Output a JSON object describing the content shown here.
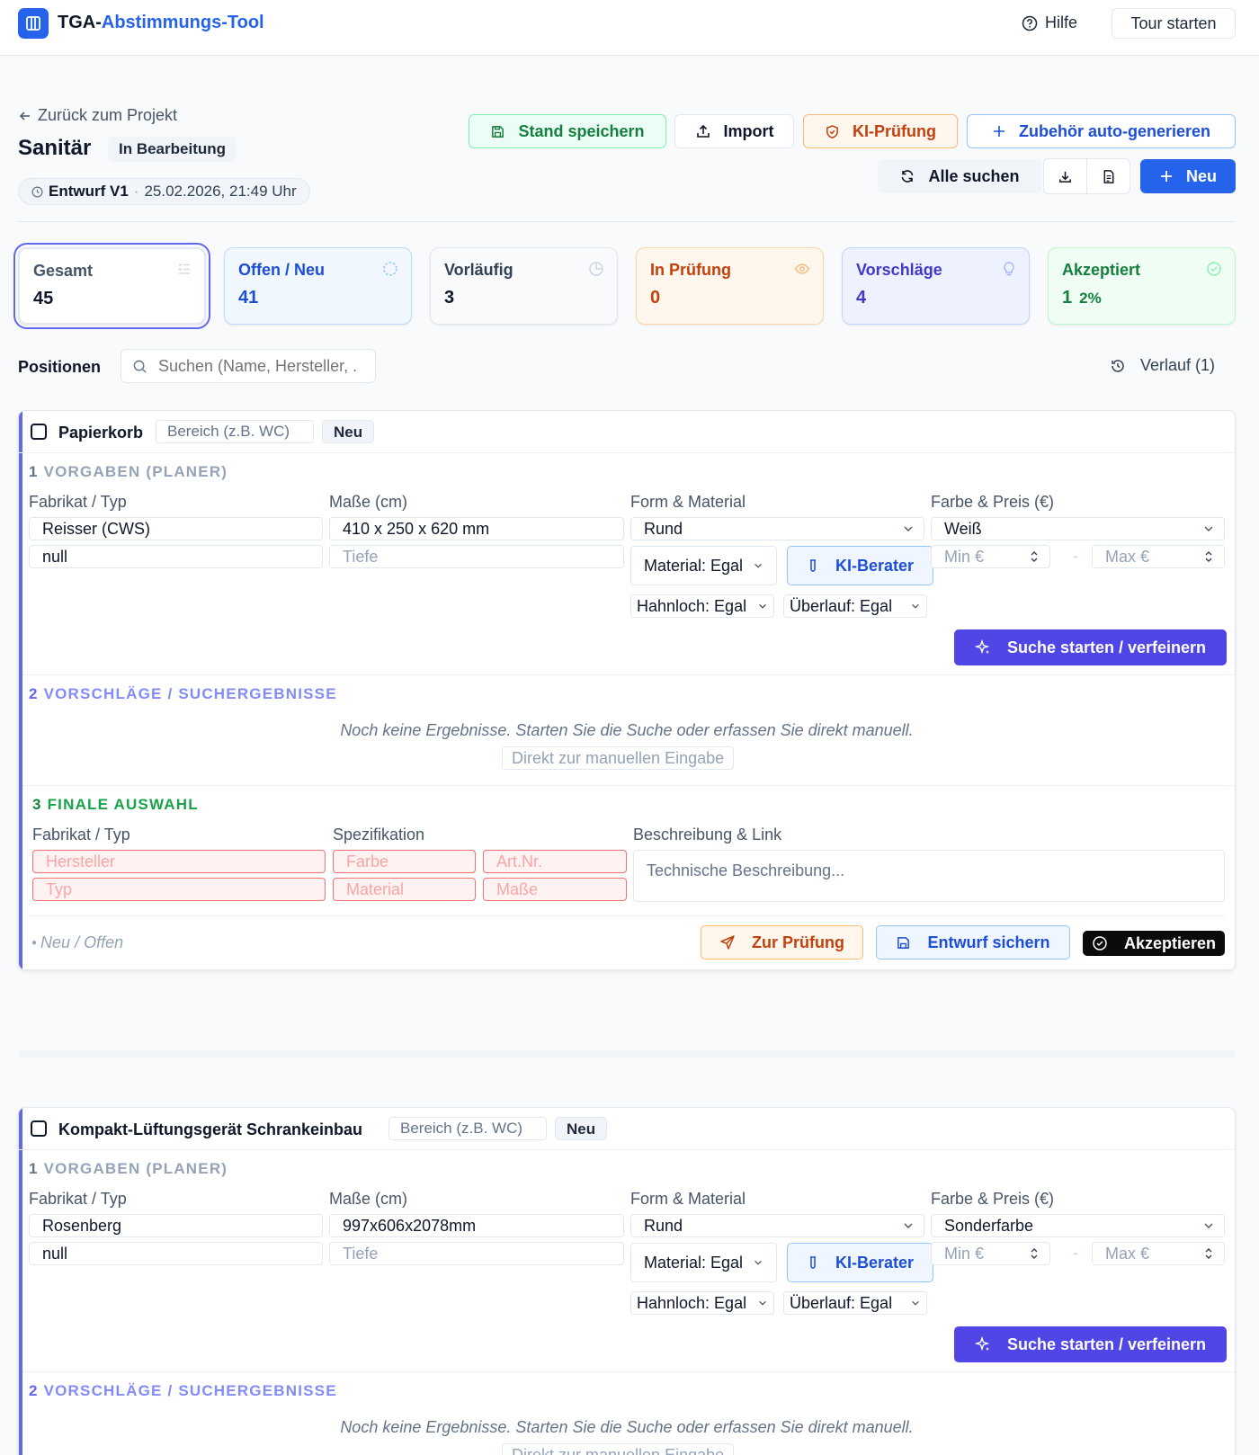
{
  "app": {
    "title_prefix": "TGA-",
    "title_accent": "Abstimmungs-Tool",
    "help_label": "Hilfe",
    "tour_label": "Tour starten"
  },
  "header": {
    "back_label": "Zurück zum Projekt",
    "title": "Sanitär",
    "status": "In Bearbeitung",
    "version_name": "Entwurf V1",
    "version_sep": "·",
    "version_date": "25.02.2026, 21:49 Uhr",
    "actions": {
      "save": "Stand speichern",
      "import": "Import",
      "ki_check": "KI-Prüfung",
      "accessories": "Zubehör auto-generieren",
      "search_all": "Alle suchen",
      "new": "Neu"
    }
  },
  "stats": [
    {
      "label": "Gesamt",
      "value": "45",
      "icon": "list-checks-icon"
    },
    {
      "label": "Offen / Neu",
      "value": "41",
      "icon": "dashed-circle-icon"
    },
    {
      "label": "Vorläufig",
      "value": "3",
      "icon": "pie-clock-icon"
    },
    {
      "label": "In Prüfung",
      "value": "0",
      "icon": "eye-icon"
    },
    {
      "label": "Vorschläge",
      "value": "4",
      "icon": "lightbulb-icon"
    },
    {
      "label": "Akzeptiert",
      "value": "1",
      "pct": "2%",
      "icon": "check-circle-icon"
    }
  ],
  "positions": {
    "label": "Positionen",
    "search_placeholder": "Suchen (Name, Hersteller, ...)",
    "history_label": "Verlauf (1)"
  },
  "common": {
    "area_placeholder": "Bereich (z.B. WC)",
    "tag_new": "Neu",
    "sec1_num": "1",
    "sec1_title": "VORGABEN (PLANER)",
    "col_fabrikat": "Fabrikat / Typ",
    "col_masse": "Maße (cm)",
    "col_form": "Form & Material",
    "col_farbe": "Farbe & Preis (€)",
    "depth_placeholder": "Tiefe",
    "material_dd": "Material: Egal",
    "ki_advisor": "KI-Berater",
    "hahnloch_dd": "Hahnloch: Egal",
    "ueberlauf_dd": "Überlauf: Egal",
    "min_placeholder": "Min €",
    "max_placeholder": "Max €",
    "range_dash": "-",
    "search_btn": "Suche starten / verfeinern",
    "sec2_num": "2",
    "sec2_title": "VORSCHLÄGE / SUCHERGEBNISSE",
    "no_results": "Noch keine Ergebnisse. Starten Sie die Suche oder erfassen Sie direkt manuell.",
    "manual_entry": "Direkt zur manuellen Eingabe",
    "sec3_num": "3",
    "sec3_title": "FINALE AUSWAHL",
    "col_spec": "Spezifikation",
    "col_desc": "Beschreibung & Link",
    "ph_hersteller": "Hersteller",
    "ph_typ": "Typ",
    "ph_farbe": "Farbe",
    "ph_material": "Material",
    "ph_artnr": "Art.Nr.",
    "ph_masse": "Maße",
    "ph_desc": "Technische Beschreibung...",
    "status_note": "Neu / Offen",
    "btn_pruefung": "Zur Prüfung",
    "btn_entwurf": "Entwurf sichern",
    "btn_akzeptieren": "Akzeptieren"
  },
  "cards": [
    {
      "name": "Papierkorb",
      "fabrikat": "Reisser (CWS)",
      "typ": "null",
      "masse": "410 x 250 x 620 mm",
      "form": "Rund",
      "farbe": "Weiß"
    },
    {
      "name": "Kompakt-Lüftungsgerät Schrankeinbau",
      "fabrikat": "Rosenberg",
      "typ": "null",
      "masse": "997x606x2078mm",
      "form": "Rund",
      "farbe": "Sonderfarbe"
    }
  ],
  "colors": {
    "primary": "#2563eb",
    "indigo": "#4f46e5",
    "green": "#16a34a",
    "orange": "#c2410c"
  }
}
